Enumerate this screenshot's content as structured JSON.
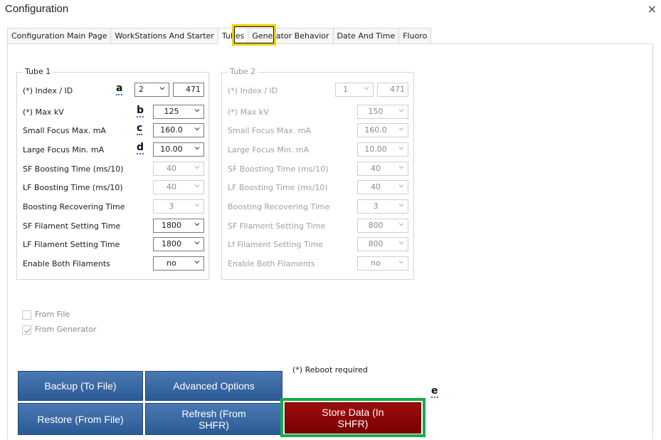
{
  "window": {
    "title": "Configuration",
    "close_glyph": "×"
  },
  "tabs": [
    {
      "label": "Configuration Main Page"
    },
    {
      "label": "WorkStations And Starter"
    },
    {
      "label": "Tubes"
    },
    {
      "label": "Generator Behavior"
    },
    {
      "label": "Date And Time"
    },
    {
      "label": "Fluoro"
    }
  ],
  "active_tab": "Tubes",
  "tube1": {
    "title": "Tube 1",
    "rows": [
      {
        "label": "(*) Index / ID",
        "value": "2",
        "id_value": "471",
        "marker": "a"
      },
      {
        "label": "(*) Max kV",
        "value": "125",
        "marker": "b"
      },
      {
        "label": "Small Focus Max. mA",
        "value": "160.0",
        "marker": "c"
      },
      {
        "label": "Large Focus Min. mA",
        "value": "10.00",
        "marker": "d"
      },
      {
        "label": "SF Boosting Time (ms/10)",
        "value": "40"
      },
      {
        "label": "LF Boosting Time (ms/10)",
        "value": "40"
      },
      {
        "label": "Boosting Recovering Time",
        "value": "3"
      },
      {
        "label": "SF Filament Setting Time",
        "value": "1800"
      },
      {
        "label": "LF Filament Setting Time",
        "value": "1800"
      },
      {
        "label": "Enable Both Filaments",
        "value": "no"
      }
    ]
  },
  "tube2": {
    "title": "Tube 2",
    "rows": [
      {
        "label": "(*) Index / ID",
        "value": "1",
        "id_value": "471"
      },
      {
        "label": "(*) Max kV",
        "value": "150"
      },
      {
        "label": "Small Focus Max. mA",
        "value": "160.0"
      },
      {
        "label": "Large Focus Min. mA",
        "value": "10.00"
      },
      {
        "label": "SF Boosting Time (ms/10)",
        "value": "40"
      },
      {
        "label": "LF Boosting Time (ms/10)",
        "value": "40"
      },
      {
        "label": "Boosting Recovering Time",
        "value": "3"
      },
      {
        "label": "SF Filament Setting Time",
        "value": "800"
      },
      {
        "label": "Lf Filament Setting Time",
        "value": "800"
      },
      {
        "label": "Enable Both Filaments",
        "value": "no"
      }
    ]
  },
  "source": {
    "from_file": {
      "label": "From File",
      "checked": false
    },
    "from_generator": {
      "label": "From Generator",
      "checked": true
    }
  },
  "reboot_note": "(*) Reboot required",
  "marker_e": "e",
  "buttons": {
    "backup": "Backup (To File)",
    "advanced": "Advanced Options",
    "restore": "Restore (From File)",
    "refresh": "Refresh (From SHFR)",
    "store": "Store Data (In SHFR)"
  },
  "colors": {
    "button_blue": "#3a68a4",
    "button_red": "#8b0000",
    "highlight_yellow": "#f0d000",
    "highlight_green": "#1aa84a"
  }
}
